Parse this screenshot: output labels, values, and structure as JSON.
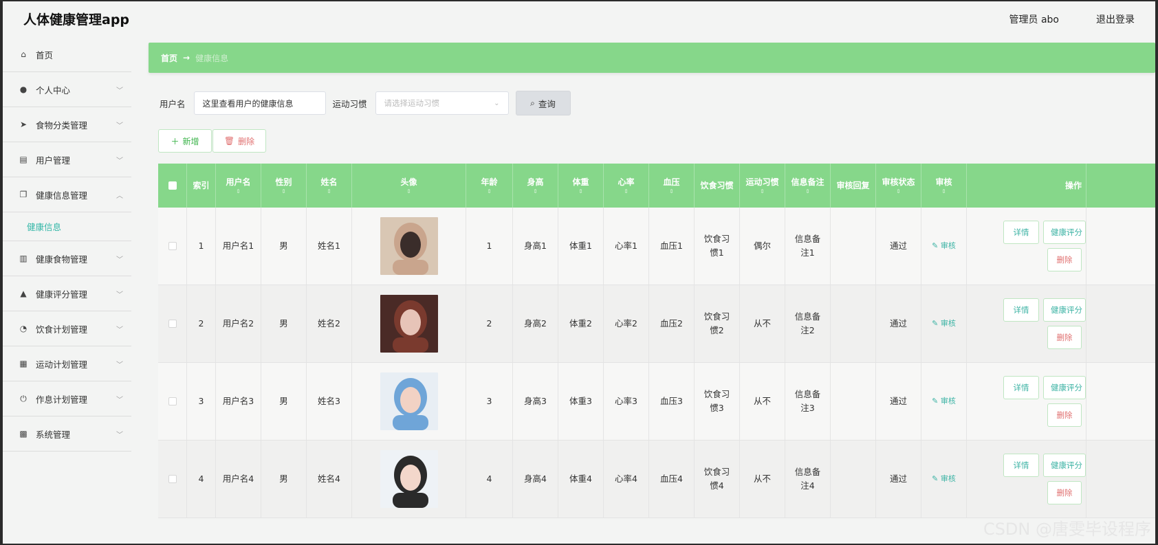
{
  "header": {
    "app_title": "人体健康管理app",
    "user_label": "管理员 abo",
    "logout": "退出登录"
  },
  "sidebar": {
    "items": [
      {
        "label": "首页",
        "icon": "home-icon",
        "glyph": "⌂",
        "has_chevron": false
      },
      {
        "label": "个人中心",
        "icon": "person-icon",
        "glyph": "●",
        "has_chevron": true
      },
      {
        "label": "食物分类管理",
        "icon": "send-icon",
        "glyph": "➤",
        "has_chevron": true
      },
      {
        "label": "用户管理",
        "icon": "printer-icon",
        "glyph": "▤",
        "has_chevron": true
      },
      {
        "label": "健康信息管理",
        "icon": "copy-icon",
        "glyph": "❐",
        "has_chevron": true,
        "expanded": true
      },
      {
        "label": "健康食物管理",
        "icon": "bar-chart-icon",
        "glyph": "▥",
        "has_chevron": true
      },
      {
        "label": "健康评分管理",
        "icon": "user-icon",
        "glyph": "▲",
        "has_chevron": true
      },
      {
        "label": "饮食计划管理",
        "icon": "dashboard-icon",
        "glyph": "◔",
        "has_chevron": true
      },
      {
        "label": "运动计划管理",
        "icon": "clipboard-icon",
        "glyph": "▦",
        "has_chevron": true
      },
      {
        "label": "作息计划管理",
        "icon": "power-icon",
        "glyph": "⏻",
        "has_chevron": true
      },
      {
        "label": "系统管理",
        "icon": "document-icon",
        "glyph": "▩",
        "has_chevron": true
      }
    ],
    "submenu": {
      "label": "健康信息"
    }
  },
  "breadcrumb": {
    "home": "首页",
    "arrow": "→",
    "current": "健康信息"
  },
  "search": {
    "username_label": "用户名",
    "username_value": "这里查看用户的健康信息",
    "habit_label": "运动习惯",
    "habit_placeholder": "请选择运动习惯",
    "query_button": "查询"
  },
  "actions": {
    "add": "新增",
    "delete": "删除"
  },
  "table": {
    "headers": [
      "索引",
      "用户名",
      "性别",
      "姓名",
      "头像",
      "年龄",
      "身高",
      "体重",
      "心率",
      "血压",
      "饮食习惯",
      "运动习惯",
      "信息备注",
      "审核回复",
      "审核状态",
      "审核",
      "操作"
    ],
    "rows": [
      {
        "index": "1",
        "username": "用户名1",
        "gender": "男",
        "name": "姓名1",
        "age": "1",
        "height": "身高1",
        "weight": "体重1",
        "heart": "心率1",
        "bp": "血压1",
        "diet": "饮食习惯1",
        "sport": "偶尔",
        "note": "信息备注1",
        "reply": "",
        "status": "通过",
        "audit": "审核",
        "avatar_colors": [
          "#d9c7b4",
          "#3a2d2a",
          "#c9a58d"
        ]
      },
      {
        "index": "2",
        "username": "用户名2",
        "gender": "男",
        "name": "姓名2",
        "age": "2",
        "height": "身高2",
        "weight": "体重2",
        "heart": "心率2",
        "bp": "血压2",
        "diet": "饮食习惯2",
        "sport": "从不",
        "note": "信息备注2",
        "reply": "",
        "status": "通过",
        "audit": "审核",
        "avatar_colors": [
          "#4a2a26",
          "#e7c4b8",
          "#7a3a2e"
        ]
      },
      {
        "index": "3",
        "username": "用户名3",
        "gender": "男",
        "name": "姓名3",
        "age": "3",
        "height": "身高3",
        "weight": "体重3",
        "heart": "心率3",
        "bp": "血压3",
        "diet": "饮食习惯3",
        "sport": "从不",
        "note": "信息备注3",
        "reply": "",
        "status": "通过",
        "audit": "审核",
        "avatar_colors": [
          "#e8eef4",
          "#f2d2c4",
          "#6fa5d8"
        ]
      },
      {
        "index": "4",
        "username": "用户名4",
        "gender": "男",
        "name": "姓名4",
        "age": "4",
        "height": "身高4",
        "weight": "体重4",
        "heart": "心率4",
        "bp": "血压4",
        "diet": "饮食习惯4",
        "sport": "从不",
        "note": "信息备注4",
        "reply": "",
        "status": "通过",
        "audit": "审核",
        "avatar_colors": [
          "#eef2f6",
          "#f3d7cb",
          "#2a2a2a"
        ]
      }
    ],
    "op_labels": {
      "detail": "详情",
      "score": "健康评分",
      "delete": "删除"
    }
  },
  "watermark": "CSDN @唐雯毕设程序",
  "colors": {
    "accent": "#86d78a",
    "teal": "#3cb3a4",
    "danger": "#e07070"
  }
}
